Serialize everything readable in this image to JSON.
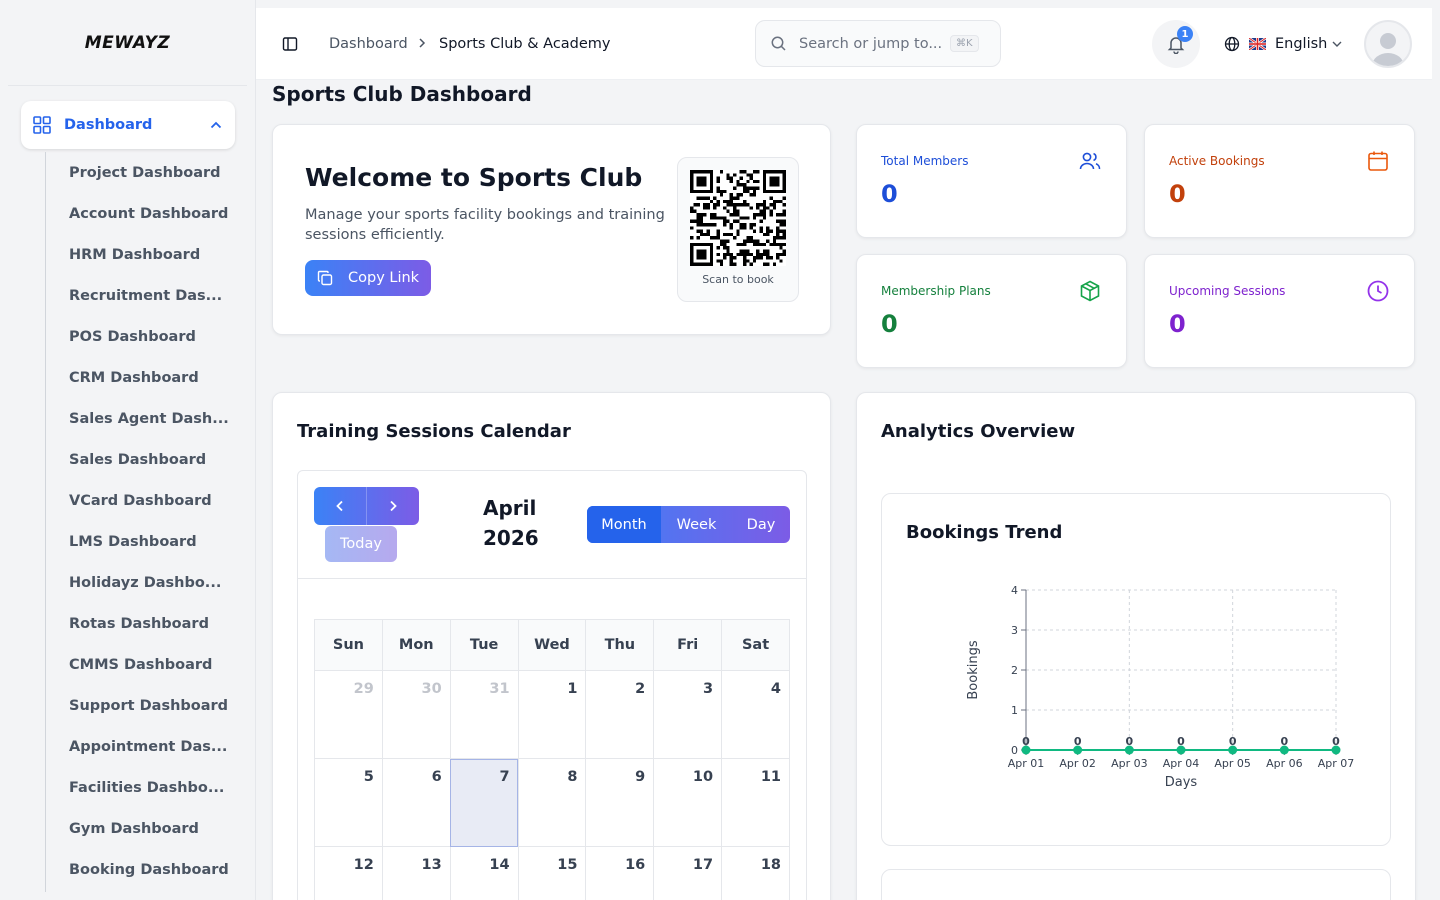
{
  "app": {
    "logo": "MEWAYZ"
  },
  "sidebar": {
    "active": {
      "label": "Dashboard",
      "icon": "grid-icon"
    },
    "items": [
      {
        "label": "Project Dashboard"
      },
      {
        "label": "Account Dashboard"
      },
      {
        "label": "HRM Dashboard"
      },
      {
        "label": "Recruitment Das..."
      },
      {
        "label": "POS Dashboard"
      },
      {
        "label": "CRM Dashboard"
      },
      {
        "label": "Sales Agent Dash..."
      },
      {
        "label": "Sales Dashboard"
      },
      {
        "label": "VCard Dashboard"
      },
      {
        "label": "LMS Dashboard"
      },
      {
        "label": "Holidayz Dashbo..."
      },
      {
        "label": "Rotas Dashboard"
      },
      {
        "label": "CMMS Dashboard"
      },
      {
        "label": "Support Dashboard"
      },
      {
        "label": "Appointment Das..."
      },
      {
        "label": "Facilities Dashbo..."
      },
      {
        "label": "Gym Dashboard"
      },
      {
        "label": "Booking Dashboard"
      }
    ]
  },
  "header": {
    "breadcrumb": [
      "Dashboard",
      "Sports Club & Academy"
    ],
    "search_placeholder": "Search or jump to...",
    "search_shortcut": "⌘K",
    "notification_count": "1",
    "language": "English"
  },
  "page": {
    "title": "Sports Club Dashboard"
  },
  "welcome": {
    "title": "Welcome to Sports Club",
    "description": "Manage your sports facility bookings and training sessions efficiently.",
    "copy_label": "Copy Link",
    "qr_caption": "Scan to book"
  },
  "stats": [
    {
      "label": "Total Members",
      "value": "0",
      "color": "#1d4ed8",
      "icon": "users-icon"
    },
    {
      "label": "Active Bookings",
      "value": "0",
      "color": "#c2410c",
      "icon": "calendar-icon"
    },
    {
      "label": "Membership Plans",
      "value": "0",
      "color": "#15803d",
      "icon": "package-icon"
    },
    {
      "label": "Upcoming Sessions",
      "value": "0",
      "color": "#7e22ce",
      "icon": "clock-icon"
    }
  ],
  "calendar": {
    "title": "Training Sessions Calendar",
    "month": "April 2026",
    "today_label": "Today",
    "views": [
      "Month",
      "Week",
      "Day"
    ],
    "active_view": "Month",
    "weekdays": [
      "Sun",
      "Mon",
      "Tue",
      "Wed",
      "Thu",
      "Fri",
      "Sat"
    ],
    "weeks": [
      [
        "29",
        "30",
        "31",
        "1",
        "2",
        "3",
        "4"
      ],
      [
        "5",
        "6",
        "7",
        "8",
        "9",
        "10",
        "11"
      ],
      [
        "12",
        "13",
        "14",
        "15",
        "16",
        "17",
        "18"
      ]
    ],
    "other_month_days": [
      "29",
      "30",
      "31"
    ],
    "today": "7"
  },
  "analytics": {
    "title": "Analytics Overview",
    "trend_title": "Bookings Trend"
  },
  "chart_data": {
    "type": "line",
    "title": "Bookings Trend",
    "xlabel": "Days",
    "ylabel": "Bookings",
    "categories": [
      "Apr 01",
      "Apr 02",
      "Apr 03",
      "Apr 04",
      "Apr 05",
      "Apr 06",
      "Apr 07"
    ],
    "series": [
      {
        "values": [
          0,
          0,
          0,
          0,
          0,
          0,
          0
        ],
        "color": "#10b981"
      }
    ],
    "ylim": [
      0,
      4
    ],
    "yticks": [
      0,
      1,
      2,
      3,
      4
    ],
    "grid": true,
    "data_labels": true
  }
}
